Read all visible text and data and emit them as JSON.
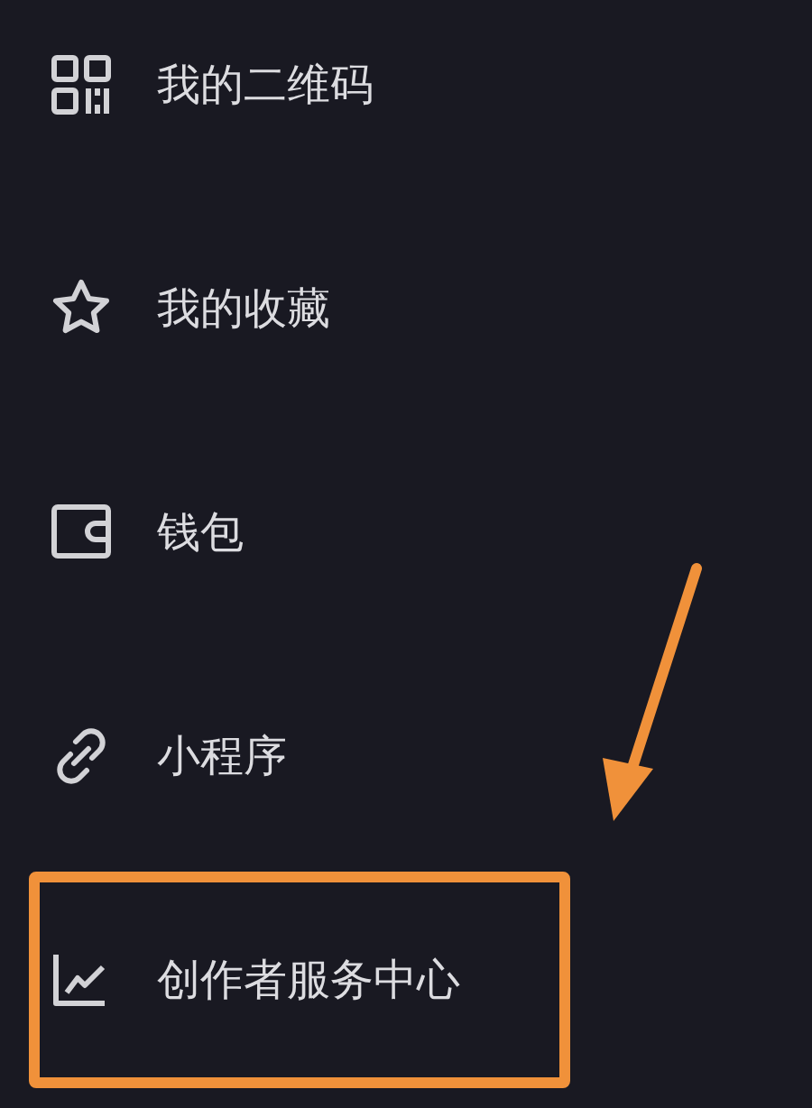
{
  "menu": {
    "items": [
      {
        "kind": "qrcode",
        "label": "我的二维码",
        "highlighted": false
      },
      {
        "kind": "star",
        "label": "我的收藏",
        "highlighted": false
      },
      {
        "kind": "wallet",
        "label": "钱包",
        "highlighted": false
      },
      {
        "kind": "link",
        "label": "小程序",
        "highlighted": false
      },
      {
        "kind": "chart",
        "label": "创作者服务中心",
        "highlighted": true
      }
    ]
  }
}
